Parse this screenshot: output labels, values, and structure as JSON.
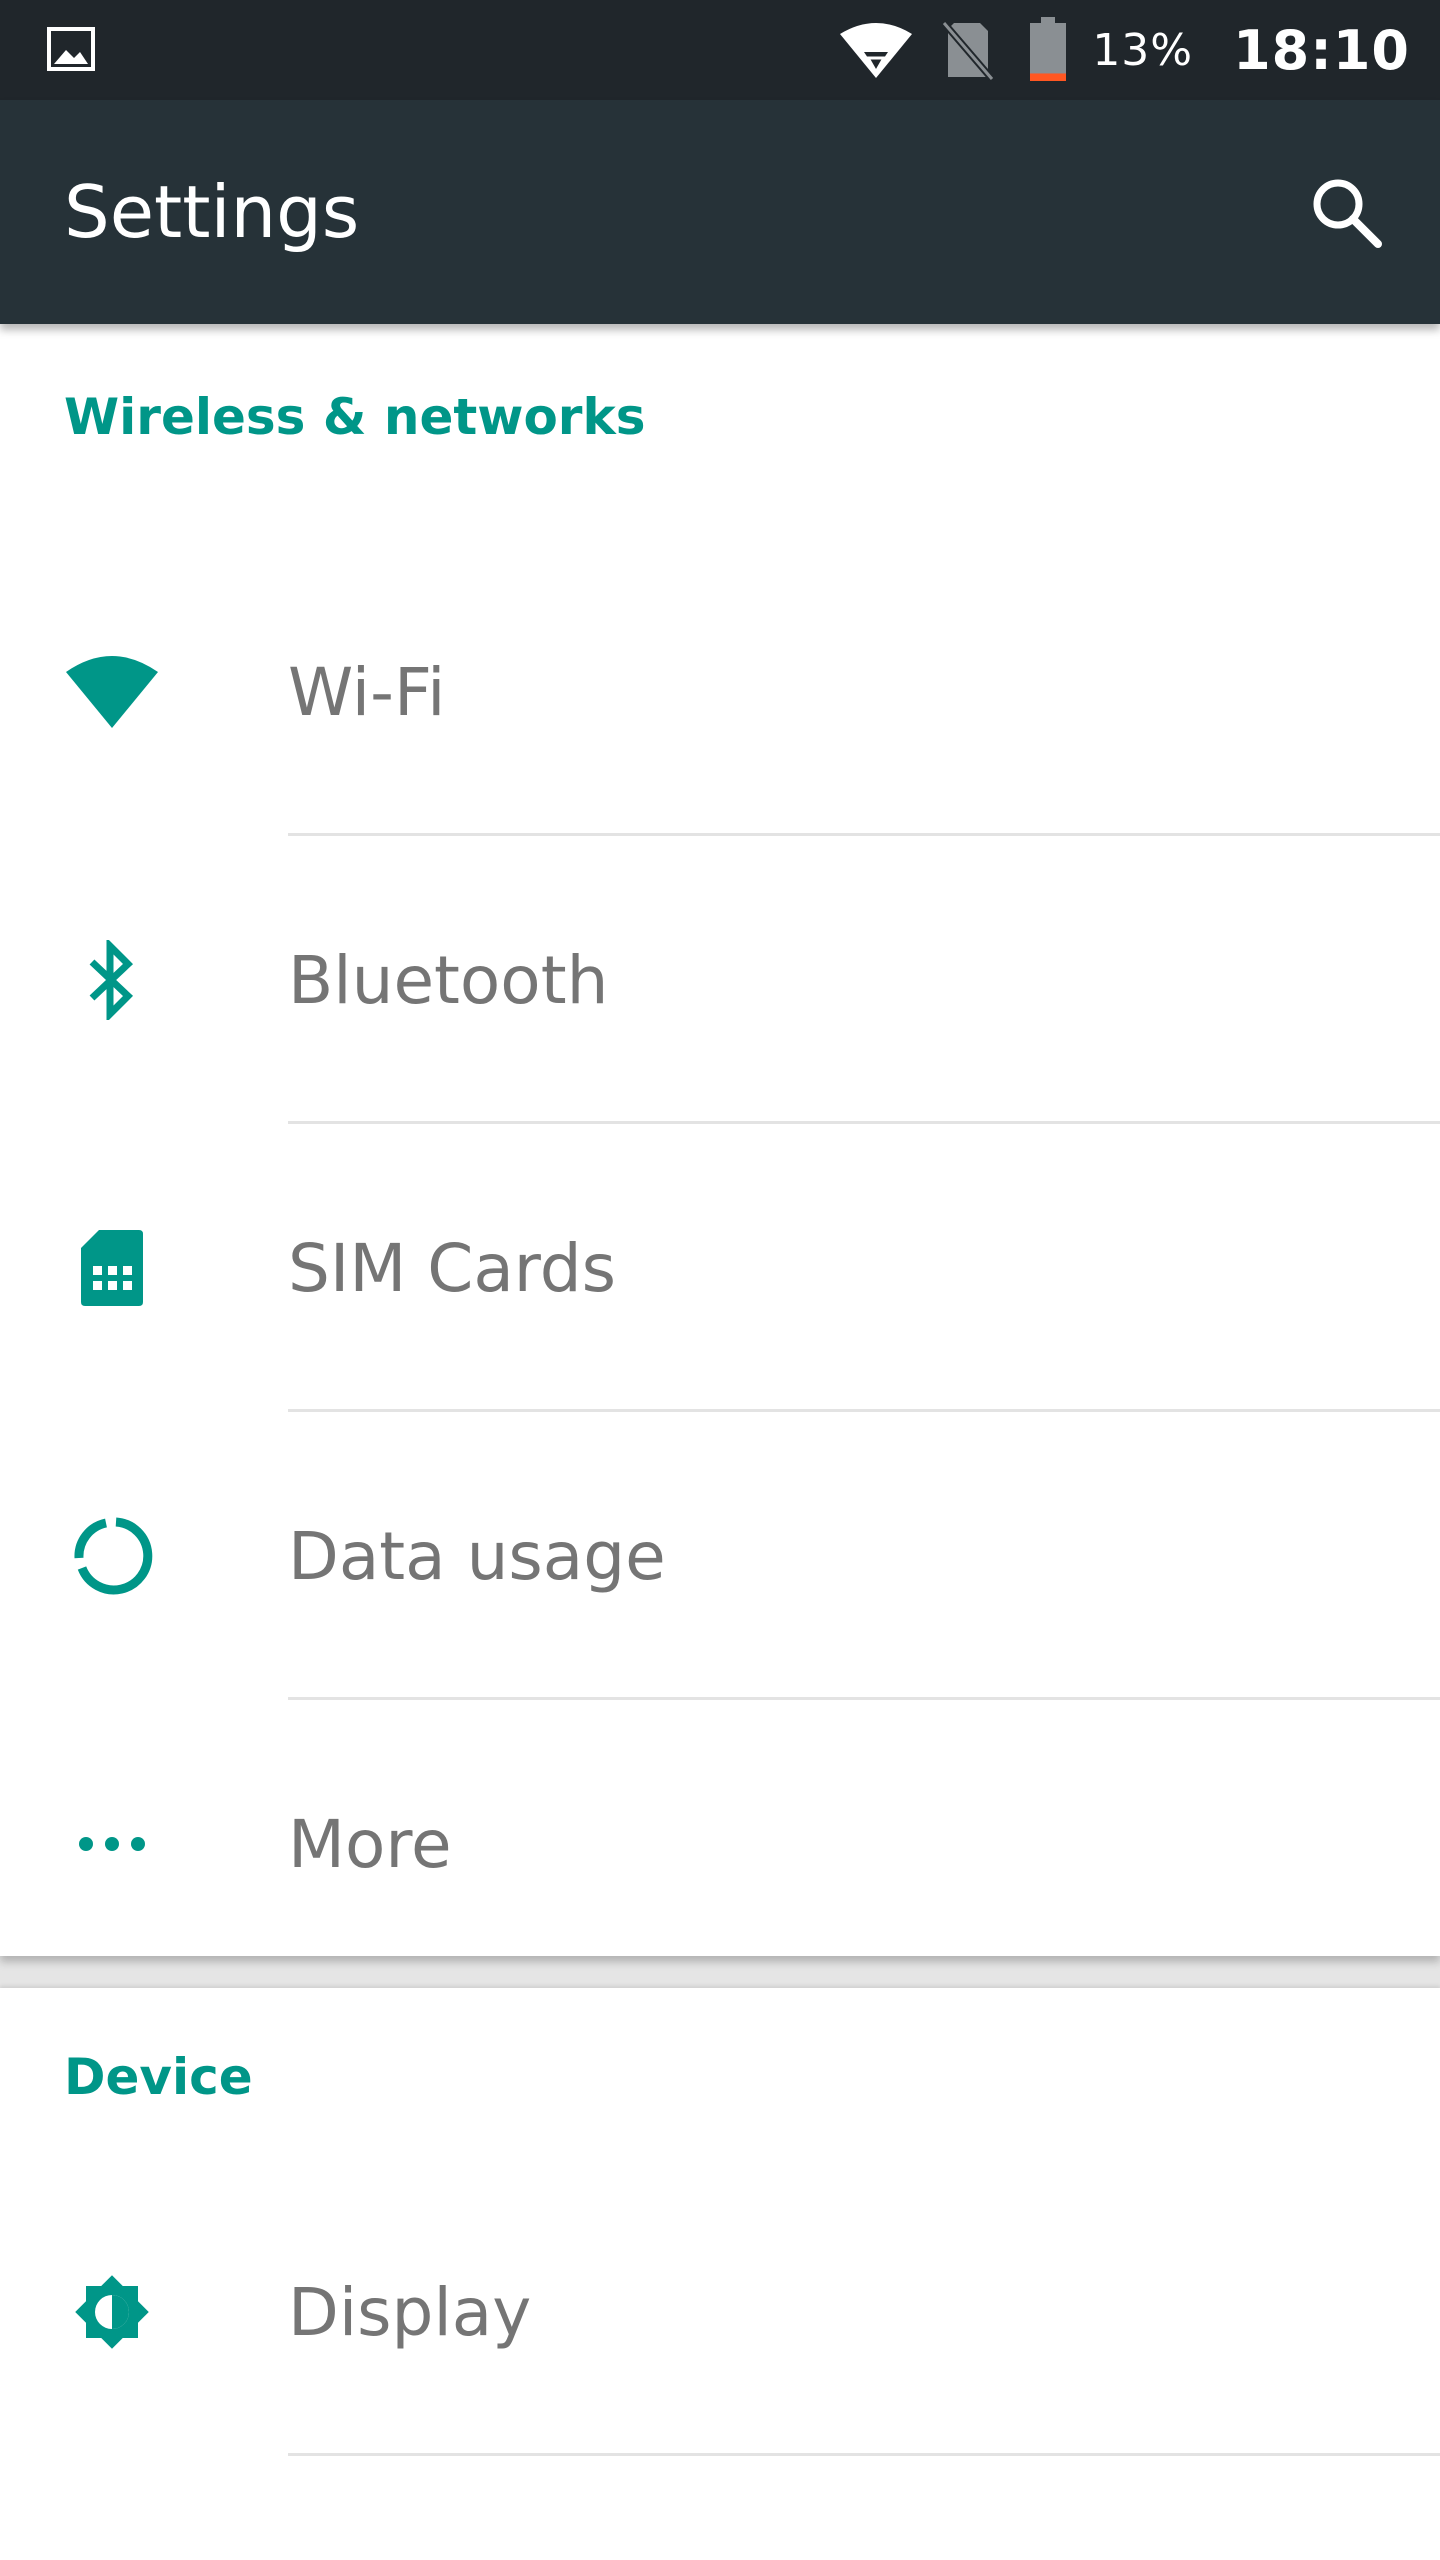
{
  "status_bar": {
    "battery_percent_text": "13%",
    "battery_level": 0.13,
    "clock": "18:10"
  },
  "app_bar": {
    "title": "Settings"
  },
  "colors": {
    "accent": "#009688",
    "app_bar": "#263238",
    "status_bar": "#20262b",
    "battery_low": "#ff5722"
  },
  "sections": [
    {
      "header": "Wireless & networks",
      "items": [
        {
          "label": "Wi-Fi",
          "icon": "wifi-icon"
        },
        {
          "label": "Bluetooth",
          "icon": "bluetooth-icon"
        },
        {
          "label": "SIM Cards",
          "icon": "sim-card-icon"
        },
        {
          "label": "Data usage",
          "icon": "data-usage-icon"
        },
        {
          "label": "More",
          "icon": "more-dots-icon"
        }
      ]
    },
    {
      "header": "Device",
      "items": [
        {
          "label": "Display",
          "icon": "display-brightness-icon"
        }
      ]
    }
  ]
}
